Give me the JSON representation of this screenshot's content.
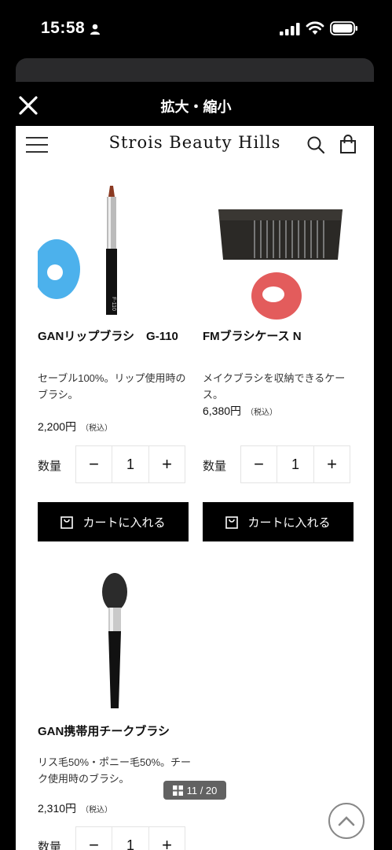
{
  "status_bar": {
    "time": "15:58"
  },
  "modal": {
    "title": "拡大・縮小"
  },
  "site": {
    "brand": "Strois Beauty Hills"
  },
  "products": [
    {
      "name": "GANリップブラシ　G-110",
      "description": "セーブル100%。リップ使用時のブラシ。",
      "price": "2,200円",
      "tax": "（税込）",
      "qty_label": "数量",
      "qty_minus": "−",
      "qty": "1",
      "qty_plus": "+",
      "cart_label": "カートに入れる",
      "image_icon": "lip-brush-icon"
    },
    {
      "name": "FMブラシケース N",
      "description": "メイクブラシを収納できるケース。",
      "price": "6,380円",
      "tax": "（税込）",
      "qty_label": "数量",
      "qty_minus": "−",
      "qty": "1",
      "qty_plus": "+",
      "cart_label": "カートに入れる",
      "image_icon": "brush-case-icon"
    },
    {
      "name": "GAN携帯用チークブラシ",
      "description": "リス毛50%・ポニー毛50%。チーク使用時のブラシ。",
      "price": "2,310円",
      "tax": "（税込）",
      "qty_label": "数量",
      "qty_minus": "−",
      "qty": "1",
      "qty_plus": "+",
      "image_icon": "cheek-brush-icon"
    }
  ],
  "pager": {
    "label": "11 / 20"
  },
  "colors": {
    "background": "#000000",
    "page": "#ffffff",
    "button": "#000000",
    "blue_mark": "#39a8ea",
    "red_mark": "#e04a4a"
  }
}
